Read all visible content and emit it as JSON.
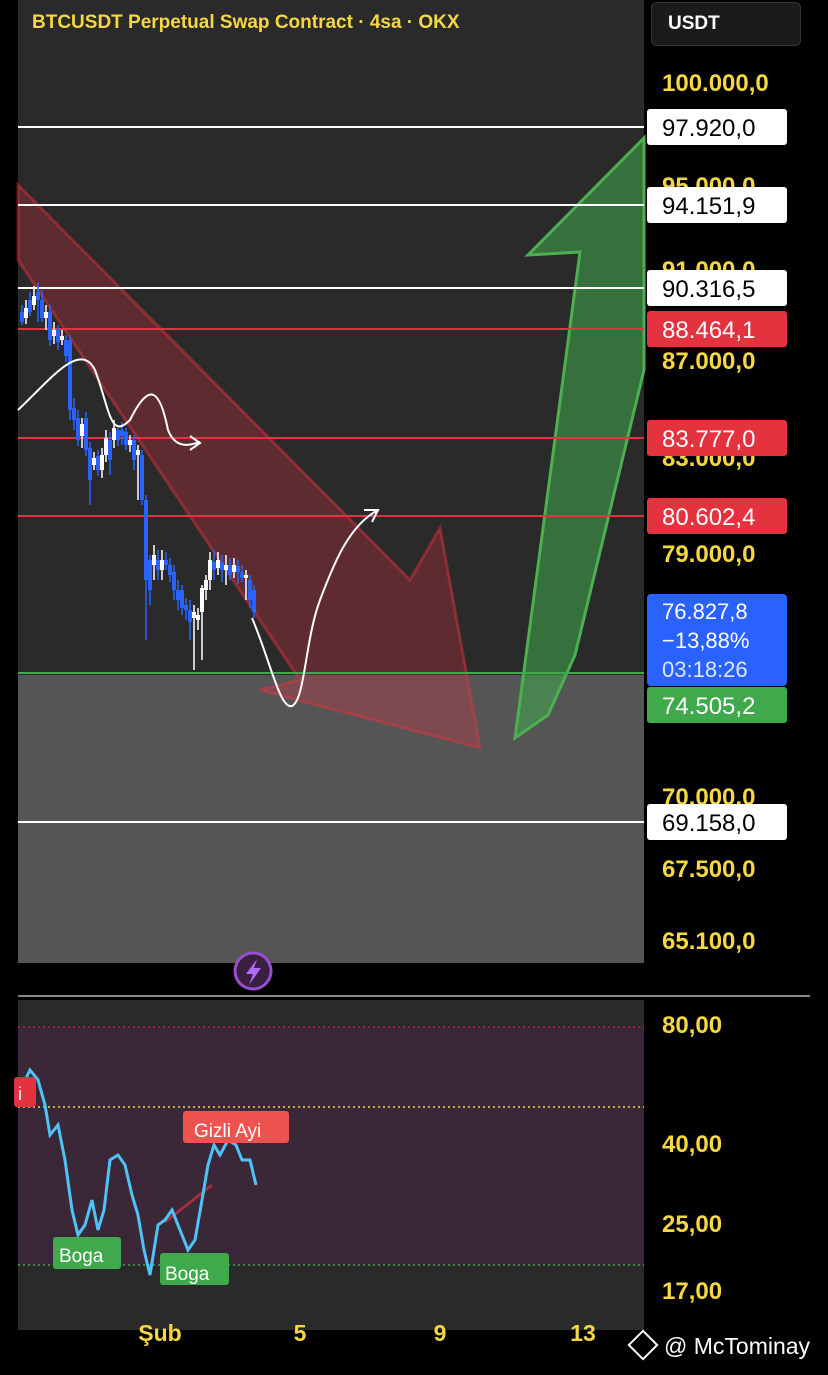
{
  "header": {
    "title": "BTCUSDT Perpetual Swap Contract · 4sa · OKX",
    "currency_button": "USDT"
  },
  "colors": {
    "accent_yellow": "#f5d742",
    "resistance_red": "#e5323f",
    "support_green": "#3fa94b",
    "price_blue": "#2962ff",
    "rsi_line": "#4fc3f7",
    "rsi_band": "#3a2838"
  },
  "price_axis": {
    "ticks": [
      "100.000,0",
      "95.000,0",
      "91.000,0",
      "87.000,0",
      "83.000,0",
      "79.000,0",
      "70.000,0",
      "67.500,0",
      "65.100,0"
    ]
  },
  "price_levels": [
    {
      "label": "97.920,0",
      "style": "white"
    },
    {
      "label": "94.151,9",
      "style": "white"
    },
    {
      "label": "90.316,5",
      "style": "white"
    },
    {
      "label": "88.464,1",
      "style": "red"
    },
    {
      "label": "83.777,0",
      "style": "red"
    },
    {
      "label": "80.602,4",
      "style": "red"
    },
    {
      "label": "74.505,2",
      "style": "green"
    },
    {
      "label": "69.158,0",
      "style": "white"
    }
  ],
  "current_price": {
    "price": "76.827,8",
    "change": "−13,88%",
    "countdown": "03:18:26"
  },
  "indicator_icon": "lightning-icon",
  "rsi_axis": {
    "ticks": [
      "80,00",
      "40,00",
      "25,00",
      "17,00"
    ]
  },
  "rsi_labels": {
    "hidden_bear": "Gizli Ayi",
    "bull_1": "Boga",
    "bull_2": "Boga",
    "edge_marker": "i"
  },
  "time_axis": {
    "ticks": [
      "Şub",
      "5",
      "9",
      "13"
    ]
  },
  "watermark": "@ McTominay"
}
